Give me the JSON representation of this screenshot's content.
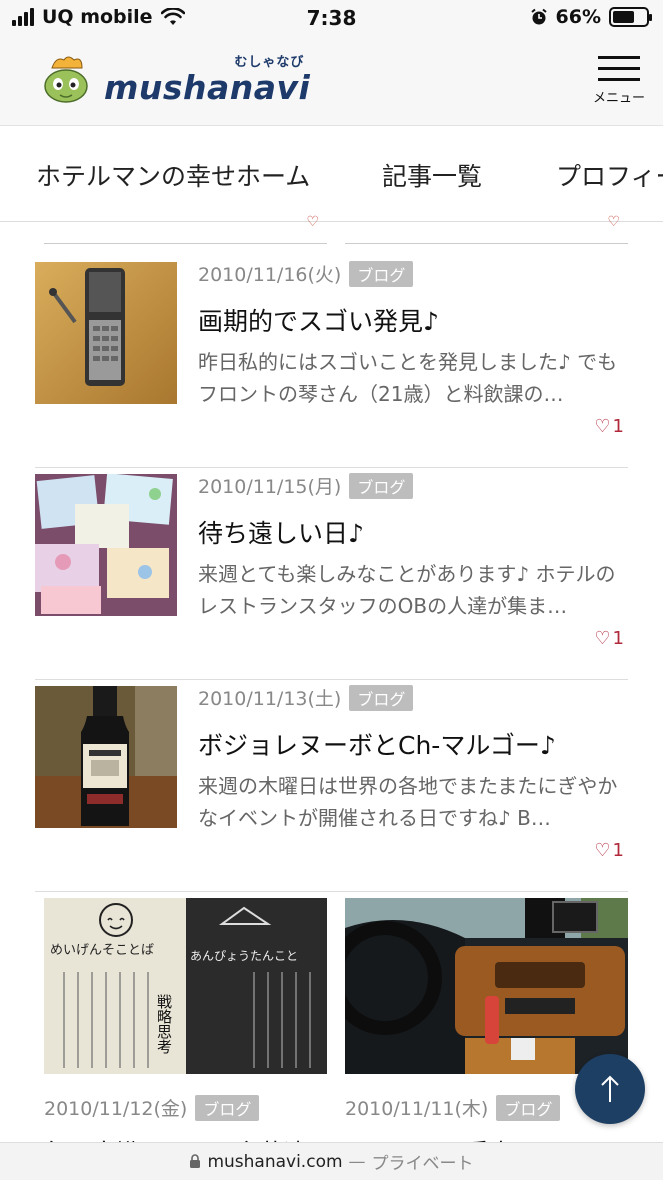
{
  "status_bar": {
    "carrier": "UQ mobile",
    "time": "7:38",
    "battery_percent": "66%",
    "battery_level": 0.66,
    "icons": [
      "signal-icon",
      "wifi-icon",
      "alarm-icon",
      "battery-icon"
    ]
  },
  "header": {
    "logo_ruby": "むしゃなび",
    "logo_text": "mushanavi",
    "menu_label": "メニュー"
  },
  "nav": {
    "items": [
      {
        "label": "ホテルマンの幸せホーム"
      },
      {
        "label": "記事一覧"
      },
      {
        "label": "プロフィー"
      }
    ]
  },
  "articles": [
    {
      "date": "2010/11/16(火)",
      "tag": "ブログ",
      "title": "画期的でスゴい発見♪",
      "excerpt": "昨日私的にはスゴいことを発見しました♪ でもフロントの琴さん（21歳）と料飲課の…",
      "likes": "1"
    },
    {
      "date": "2010/11/15(月)",
      "tag": "ブログ",
      "title": "待ち遠しい日♪",
      "excerpt": "来週とても楽しみなことがあります♪ ホテルのレストランスタッフのOBの人達が集ま…",
      "likes": "1"
    },
    {
      "date": "2010/11/13(土)",
      "tag": "ブログ",
      "title": "ボジョレヌーボとCh-マルゴー♪",
      "excerpt": "来週の木曜日は世界の各地でまたまたにぎやかなイベントが開催される日ですね♪ B…",
      "likes": "1"
    }
  ],
  "cards": [
    {
      "date": "2010/11/12(金)",
      "tag": "ブログ",
      "title": "毎日意識している言葉達",
      "img_text_left": "めいげんそことば",
      "img_text_right": "あんぴょうたんこと",
      "img_text_center": "戦略思考"
    },
    {
      "date": "2010/11/11(木)",
      "tag": "ブログ",
      "title": "ニューカセ愛車♪"
    }
  ],
  "url_bar": {
    "domain": "mushanavi.com",
    "separator": "—",
    "mode": "プライベート"
  },
  "colors": {
    "brand": "#1d3a6b",
    "heart": "#b0283a",
    "tag_bg": "#bdbdbd",
    "to_top_bg": "#1d3f63"
  }
}
